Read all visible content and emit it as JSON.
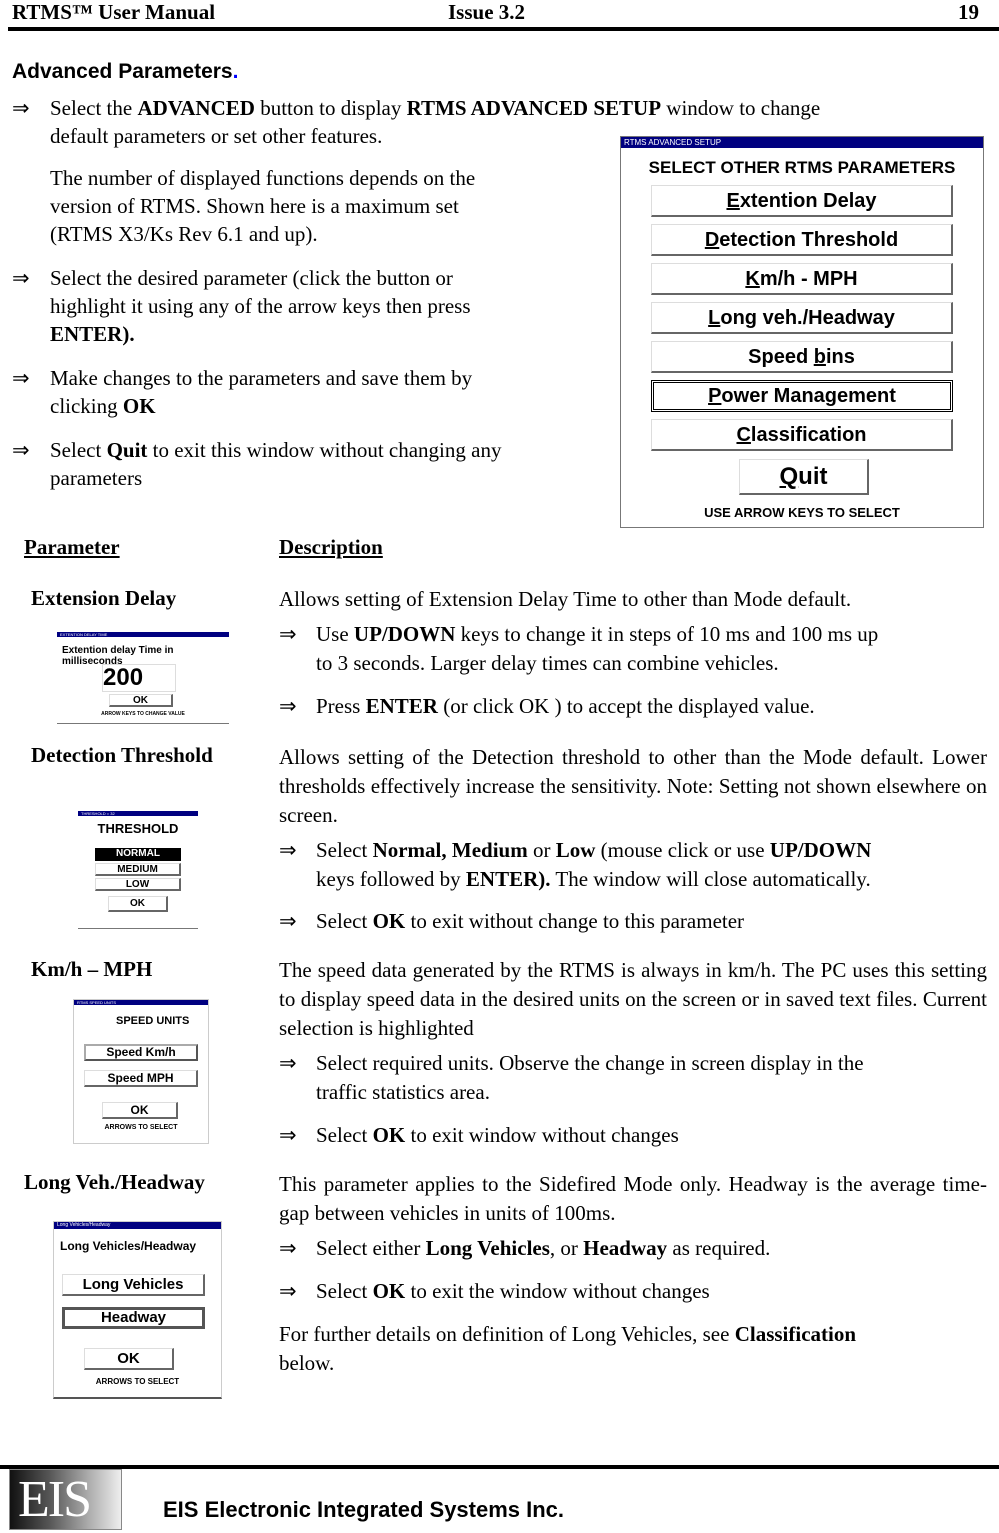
{
  "header": {
    "manual_title": "RTMS™ User Manual",
    "issue": "Issue 3.2",
    "page_number": "19"
  },
  "section": {
    "title": "Advanced Parameters",
    "title_dot": "."
  },
  "intro": {
    "arrow": "⇒",
    "b1_pre": "Select  the ",
    "b1_bold1": "ADVANCED",
    "b1_mid": " button to display ",
    "b1_bold2": "RTMS ADVANCED SETUP",
    "b1_post": " window to change",
    "b1_line2": "default parameters or set other features.",
    "note_lines": [
      "The number of displayed functions depends on the",
      "version of RTMS.  Shown here is a maximum set",
      "(RTMS X3/Ks Rev 6.1 and up)."
    ],
    "b2_lines": [
      "Select the desired parameter (click the button or",
      "highlight it using any of the arrow keys then press"
    ],
    "b2_bold": "ENTER).",
    "b3_line1": "Make changes to the parameters and save them by",
    "b3_pre": "clicking ",
    "b3_bold": "OK",
    "b4_pre": "Select ",
    "b4_bold": "Quit",
    "b4_post": " to exit this window without changing any",
    "b4_line2": "parameters"
  },
  "advanced_window": {
    "titlebar": "RTMS ADVANCED SETUP",
    "heading": "SELECT OTHER RTMS PARAMETERS",
    "buttons": [
      {
        "hot": "E",
        "rest": "xtention Delay"
      },
      {
        "hot": "D",
        "rest": "etection Threshold"
      },
      {
        "hot": "K",
        "rest": "m/h - MPH"
      },
      {
        "hot": "L",
        "rest": "ong veh./Headway"
      },
      {
        "pre": "Speed ",
        "hot": "b",
        "rest": "ins"
      },
      {
        "hot": "P",
        "rest": "ower Management"
      },
      {
        "hot": "C",
        "rest": "lassification"
      }
    ],
    "quit": {
      "hot": "Q",
      "rest": "uit"
    },
    "footer": "USE ARROW KEYS TO SELECT"
  },
  "table": {
    "col_parameter": "Parameter",
    "col_description": "Description",
    "rows": [
      {
        "name": "Extension Delay",
        "window": {
          "titlebar": "EXTENTION DELAY TIME",
          "heading": "Extention delay Time in milliseconds",
          "value": "200",
          "ok": "OK",
          "footer": "ARROW KEYS TO CHANGE VALUE"
        },
        "desc": "Allows setting of Extension Delay Time to other than Mode default.",
        "b1_pre": "Use ",
        "b1_bold": "UP/DOWN",
        "b1_post": " keys to change it in steps of 10 ms and 100 ms up",
        "b1_line2": "to 3 seconds. Larger delay times can combine vehicles.",
        "b2_pre": "Press ",
        "b2_bold": "ENTER",
        "b2_post": " (or click OK ) to accept the displayed value."
      },
      {
        "name": "Detection Threshold",
        "window": {
          "titlebar": "THRESHOLD = 32",
          "heading": "THRESHOLD",
          "options": [
            "NORMAL",
            "MEDIUM",
            "LOW"
          ],
          "selected": "NORMAL",
          "ok": "OK"
        },
        "desc": "Allows setting of the Detection threshold to other than the Mode default. Lower thresholds effectively increase the sensitivity. Note: Setting not shown elsewhere on screen.",
        "b1_pre": "Select ",
        "b1_bold": "Normal, Medium",
        "b1_mid": " or ",
        "b1_bold2": "Low",
        "b1_mid2": " (mouse click or use ",
        "b1_bold3": "UP/DOWN",
        "b1_line2_pre": "keys followed by ",
        "b1_line2_bold": "ENTER).",
        "b1_line2_post": "  The window will close automatically.",
        "b2_pre": "Select ",
        "b2_bold": "OK",
        "b2_post": " to exit without change to this parameter"
      },
      {
        "name": "Km/h – MPH",
        "window": {
          "titlebar": "RTMS SPEED UNITS",
          "heading": "SPEED UNITS",
          "options": [
            "Speed Km/h",
            "Speed MPH"
          ],
          "selected": "Speed Km/h",
          "ok": "OK",
          "footer": "ARROWS TO SELECT"
        },
        "desc": "The speed data generated by the RTMS is always in km/h. The PC uses this setting to display speed data in the desired units on the screen or in saved text files. Current selection is highlighted",
        "b1_line1": "Select required units. Observe the change in screen display in the",
        "b1_line2": "traffic statistics area.",
        "b2_pre": "Select ",
        "b2_bold": "OK",
        "b2_post": " to exit window without changes"
      },
      {
        "name": "Long Veh./Headway",
        "window": {
          "titlebar": "Long Vehicles/Headway",
          "heading": "Long Vehicles/Headway",
          "options": [
            "Long Vehicles",
            "Headway"
          ],
          "selected": "Headway",
          "ok": "OK",
          "footer": "ARROWS TO SELECT"
        },
        "desc": "This parameter applies to the Sidefired Mode only. Headway is the average time-gap between vehicles in units of 100ms.",
        "b1_pre": "Select either ",
        "b1_bold": "Long Vehicles",
        "b1_mid": ", or ",
        "b1_bold2": "Headway",
        "b1_post": " as required.",
        "b2_pre": "Select ",
        "b2_bold": "OK",
        "b2_post": " to exit the window without changes",
        "note_pre": "For further details on definition of Long Vehicles, see ",
        "note_bold": "Classification",
        "note_post": "below."
      }
    ]
  },
  "footer": {
    "logo_text": "EIS",
    "company": "EIS Electronic Integrated Systems Inc."
  }
}
